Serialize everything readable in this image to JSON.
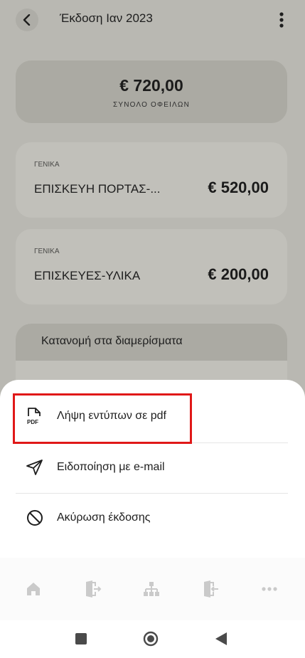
{
  "header": {
    "title": "Έκδοση Ιαν 2023",
    "back_icon": "chevron-left-icon",
    "menu_icon": "more-vertical-icon"
  },
  "summary": {
    "amount": "€ 720,00",
    "label": "ΣΥΝΟΛΟ ΟΦΕΙΛΩΝ"
  },
  "expenses": [
    {
      "category": "ΓΕΝΙΚΑ",
      "name": "ΕΠΙΣΚΕΥΗ ΠΟΡΤΑΣ-...",
      "amount": "€ 520,00"
    },
    {
      "category": "ΓΕΝΙΚΑ",
      "name": "ΕΠΙΣΚΕΥΕΣ-ΥΛΙΚΑ",
      "amount": "€ 200,00"
    }
  ],
  "allocation": {
    "title": "Κατανομή στα διαμερίσματα"
  },
  "sheet": {
    "items": [
      {
        "label": "Λήψη εντύπων σε pdf",
        "icon": "pdf-file-icon"
      },
      {
        "label": "Ειδοποίηση με e-mail",
        "icon": "send-icon"
      },
      {
        "label": "Ακύρωση έκδοσης",
        "icon": "block-icon"
      }
    ]
  },
  "nav": {
    "items": [
      "home-icon",
      "exit-door-icon",
      "hierarchy-icon",
      "enter-door-icon",
      "more-horizontal-icon"
    ]
  },
  "colors": {
    "highlight": "#e01818",
    "nav_icon": "#c9c9c9",
    "scrim_background": "#b9b8b2"
  }
}
